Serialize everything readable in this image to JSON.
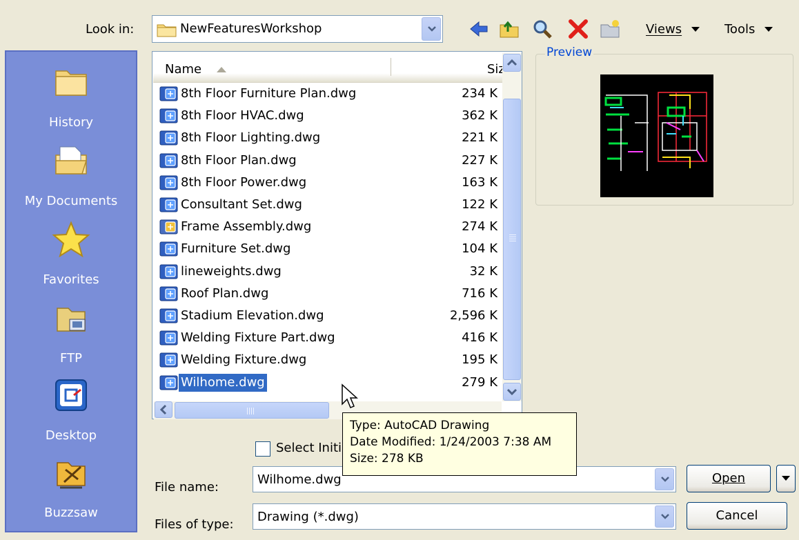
{
  "lookin": {
    "label": "Look in:",
    "value": "NewFeaturesWorkshop"
  },
  "toolbar": {
    "icons": [
      "back-icon",
      "up-folder-icon",
      "search-web-icon",
      "delete-icon",
      "new-folder-icon"
    ],
    "views_label": "Views",
    "tools_label": "Tools"
  },
  "places": [
    {
      "label": "History",
      "icon": "history-folder-icon"
    },
    {
      "label": "My Documents",
      "icon": "my-documents-icon"
    },
    {
      "label": "Favorites",
      "icon": "favorites-star-icon"
    },
    {
      "label": "FTP",
      "icon": "ftp-icon"
    },
    {
      "label": "Desktop",
      "icon": "desktop-icon"
    },
    {
      "label": "Buzzsaw",
      "icon": "buzzsaw-icon"
    }
  ],
  "file_list": {
    "columns": {
      "name": "Name",
      "size": "Siz"
    },
    "files": [
      {
        "name": "8th Floor Furniture Plan.dwg",
        "size": "234 K"
      },
      {
        "name": "8th Floor HVAC.dwg",
        "size": "362 K"
      },
      {
        "name": "8th Floor Lighting.dwg",
        "size": "221 K"
      },
      {
        "name": "8th Floor Plan.dwg",
        "size": "227 K"
      },
      {
        "name": "8th Floor Power.dwg",
        "size": "163 K"
      },
      {
        "name": "Consultant Set.dwg",
        "size": "122 K"
      },
      {
        "name": "Frame Assembly.dwg",
        "size": "274 K"
      },
      {
        "name": "Furniture Set.dwg",
        "size": "104 K"
      },
      {
        "name": "lineweights.dwg",
        "size": "32 K"
      },
      {
        "name": "Roof Plan.dwg",
        "size": "716 K"
      },
      {
        "name": "Stadium Elevation.dwg",
        "size": "2,596 K"
      },
      {
        "name": "Welding Fixture Part.dwg",
        "size": "416 K"
      },
      {
        "name": "Welding Fixture.dwg",
        "size": "195 K"
      },
      {
        "name": "Wilhome.dwg",
        "size": "279 K"
      }
    ],
    "selected_index": 13
  },
  "preview": {
    "label": "Preview"
  },
  "select_initial": {
    "label": "Select Initi"
  },
  "tooltip": {
    "type": "Type: AutoCAD Drawing",
    "modified": "Date Modified: 1/24/2003 7:38 AM",
    "size": "Size: 278 KB"
  },
  "file_name": {
    "label": "File name:",
    "value": "Wilhome.dwg"
  },
  "file_type": {
    "label": "Files of type:",
    "value": "Drawing (*.dwg)"
  },
  "buttons": {
    "open": "Open",
    "cancel": "Cancel"
  },
  "colors": {
    "selection": "#316ac5",
    "places_bg": "#7a8ed8",
    "dialog_bg": "#ece9d8",
    "tooltip_bg": "#ffffe1"
  }
}
